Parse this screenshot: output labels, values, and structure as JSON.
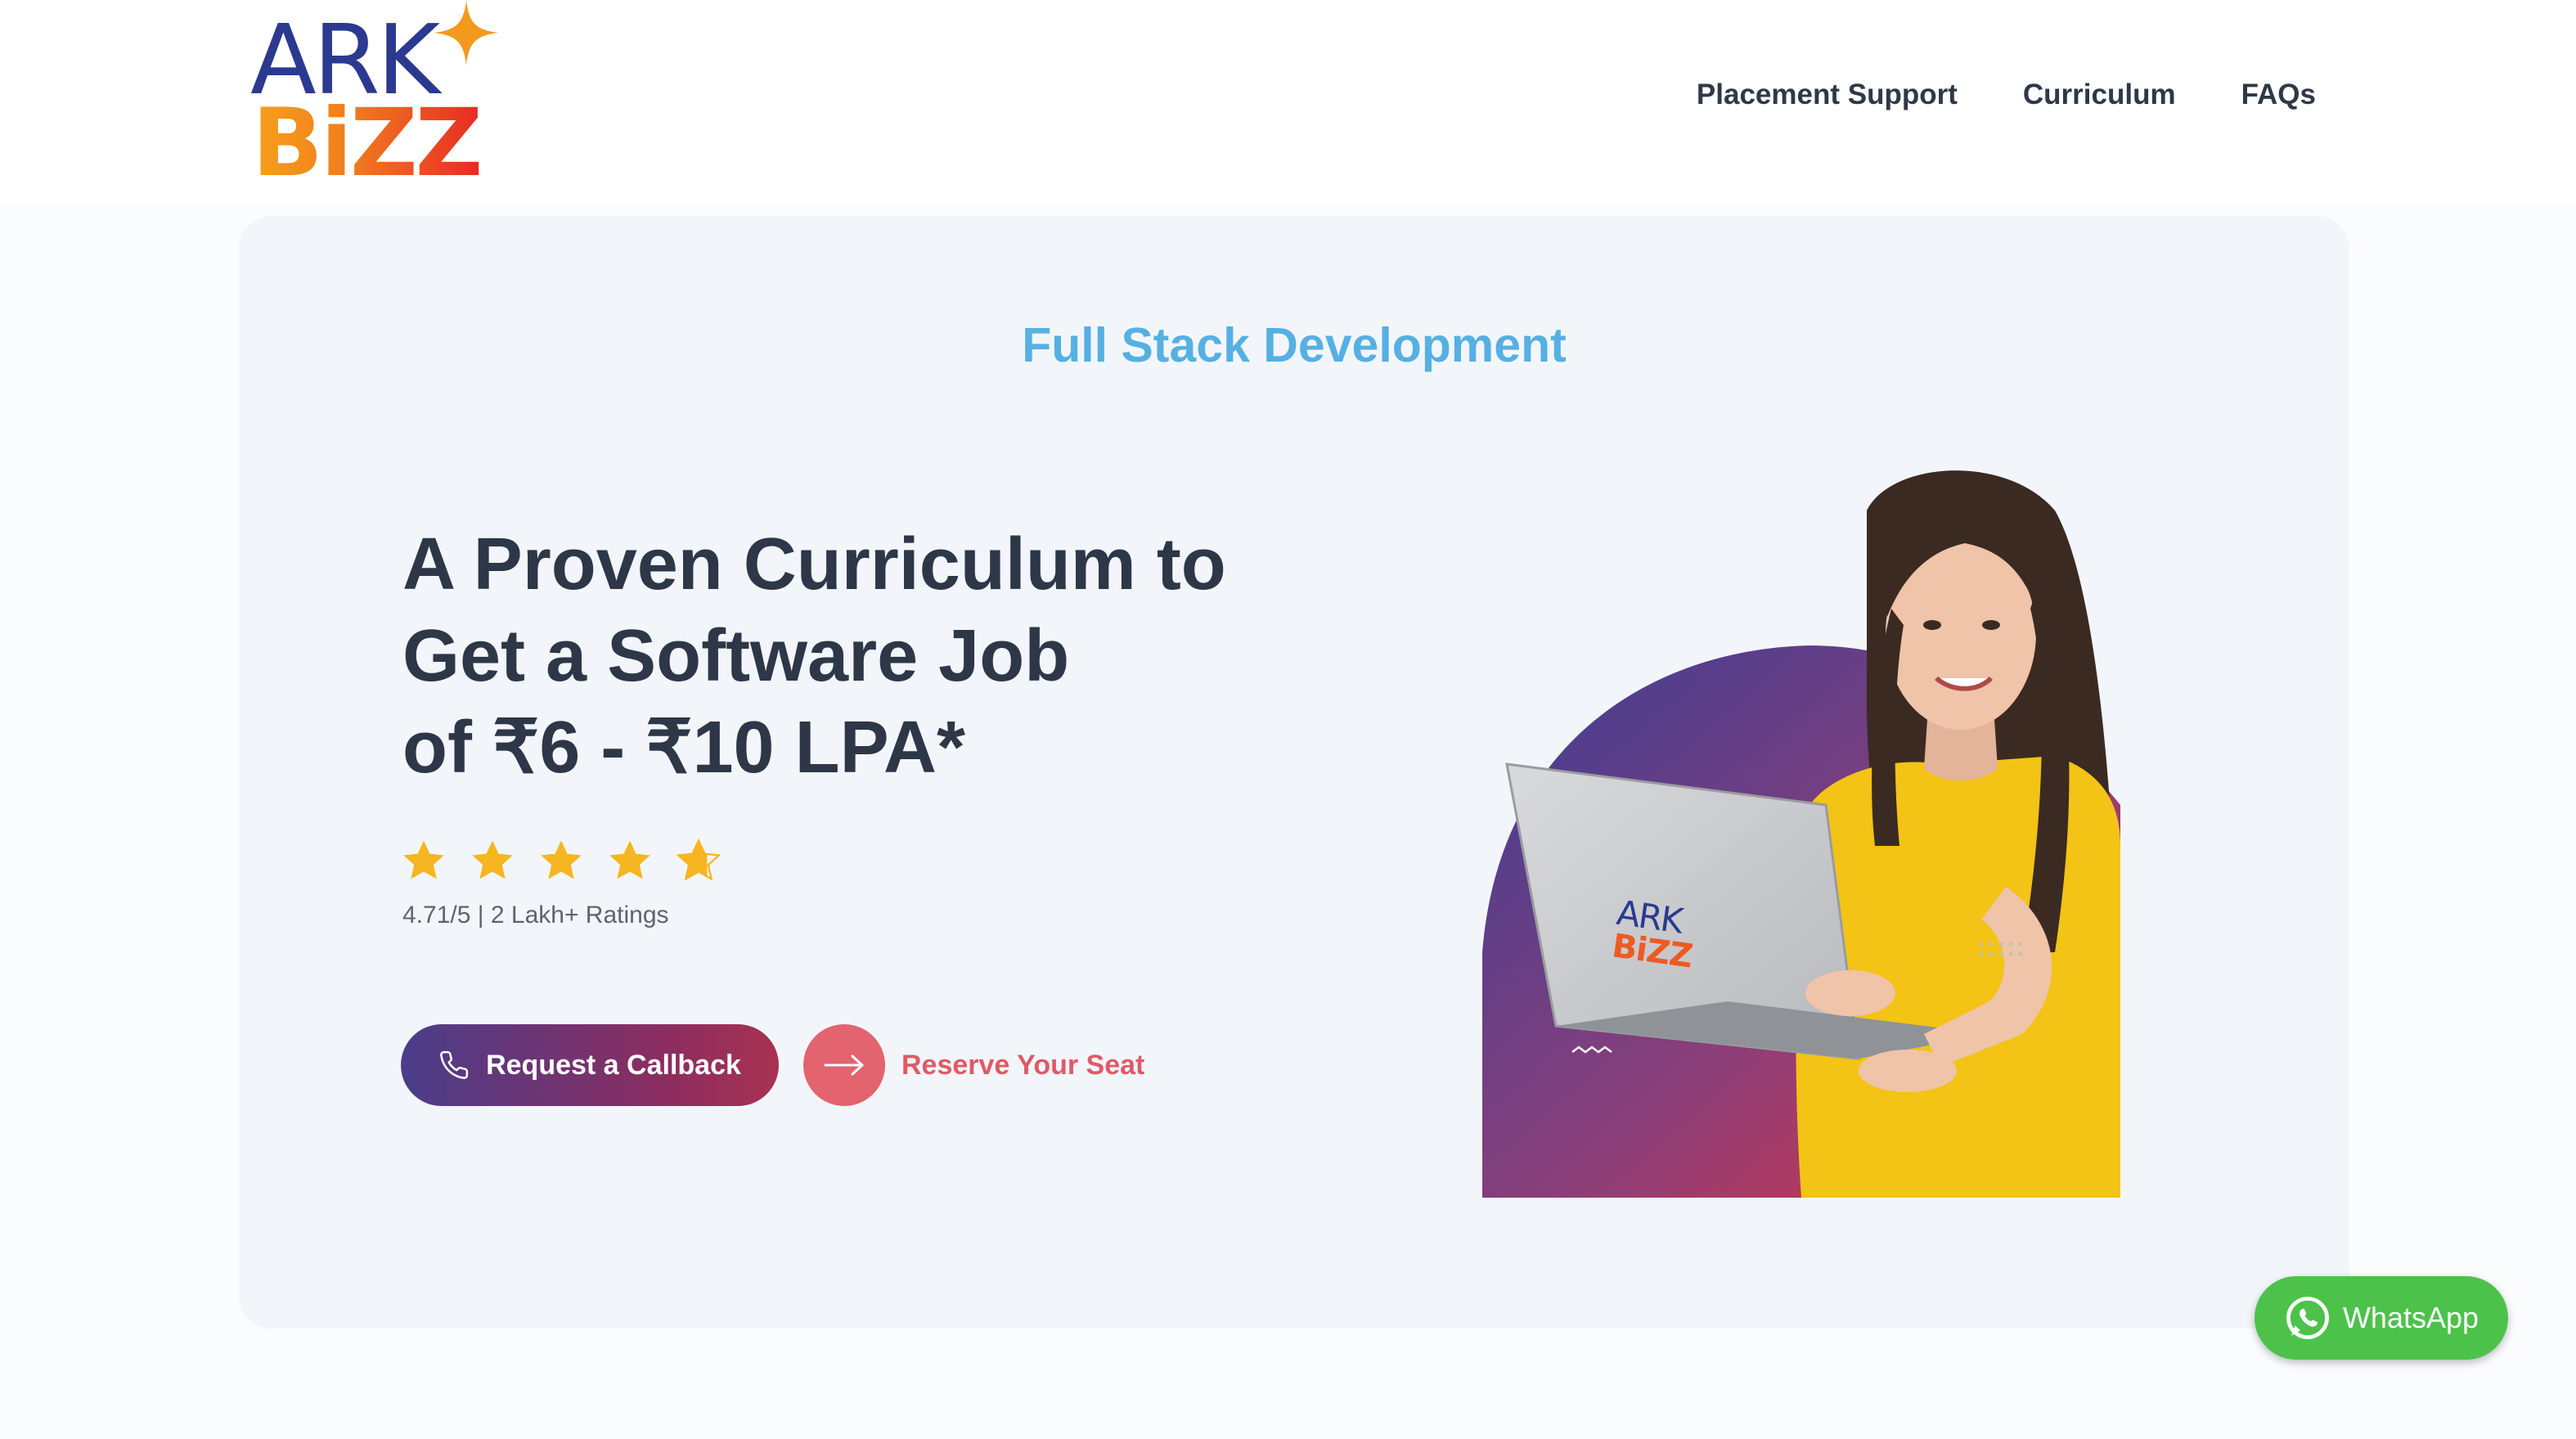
{
  "brand": {
    "logo_top": "ARK",
    "logo_bottom": "BiZZ"
  },
  "nav": {
    "items": [
      {
        "label": "Placement Support"
      },
      {
        "label": "Curriculum"
      },
      {
        "label": "FAQs"
      }
    ]
  },
  "hero": {
    "eyebrow": "Full Stack Development",
    "headline_lines": [
      "A Proven Curriculum to",
      "Get a Software Job",
      "of ₹6 - ₹10 LPA*"
    ],
    "rating": {
      "stars": 4.71,
      "max_stars": 5,
      "text": "4.71/5 | 2 Lakh+ Ratings",
      "star_color": "#f7b521"
    },
    "callback_button": {
      "label": "Request a Callback",
      "icon": "phone-icon"
    },
    "reserve_link": {
      "label": "Reserve Your Seat",
      "icon": "arrow-right-icon"
    },
    "image": {
      "description_icon": "student-with-laptop-illustration",
      "laptop_logo_top": "ARK",
      "laptop_logo_bottom": "BiZZ"
    }
  },
  "whatsapp": {
    "label": "WhatsApp",
    "icon": "whatsapp-icon",
    "color": "#4cc24a"
  },
  "colors": {
    "accent_blue": "#56b0e3",
    "heading": "#2e3748",
    "reserve_red": "#e05a67"
  }
}
